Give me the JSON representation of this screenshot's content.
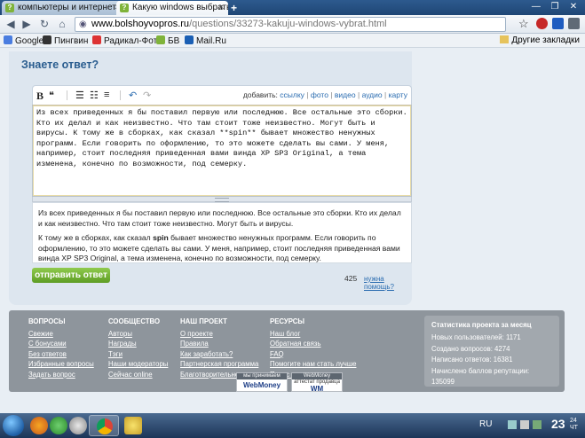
{
  "browser": {
    "tabs": [
      {
        "label": "компьютеры и интернет",
        "active": false
      },
      {
        "label": "Какую windows выбрать?",
        "active": true
      }
    ],
    "new_tab": "+",
    "address": {
      "host": "www.bolshoyvopros.ru",
      "path": "/questions/33273-kakuju-windows-vybrat.html"
    },
    "bookmarks": [
      "Google",
      "Пингвин",
      "Радикал-Фото",
      "БВ",
      "Mail.Ru"
    ],
    "other_bookmarks": "Другие закладки"
  },
  "answer": {
    "title": "Знаете ответ?",
    "toolbar": {
      "bold": "B",
      "quote": "❝",
      "add_label": "добавить:",
      "links": [
        "ссылку",
        "фото",
        "видео",
        "аудио",
        "карту"
      ],
      "separator": "|"
    },
    "textarea_text": "Из всех приведенных я бы поставил первую или последнюю. Все остальные это сборки. Кто их делал и как неизвестно. Что там стоит тоже неизвестно. Могут быть и вирусы. К тому же в сборках, как сказал **spin** бывает множество ненужных программ. Если говорить по оформлению, то это можете сделать вы сами. У меня, например, стоит последняя приведенная вами винда XP SP3 Original, а тема изменена, конечно по возможности, под семерку.",
    "preview": {
      "p1": "Из всех приведенных я бы поставил первую или последнюю. Все остальные это сборки. Кто их делал и как неизвестно. Что там стоит тоже неизвестно. Могут быть и вирусы.",
      "p2_before": "К тому же в сборках, как сказал ",
      "p2_bold": "spin",
      "p2_after": " бывает множество ненужных программ. Если говорить по оформлению, то это можете сделать вы сами. У меня, например, стоит последняя приведенная вами винда XP SP3 Original, а тема изменена, конечно по возможности, под семерку."
    },
    "submit_label": "отправить ответ",
    "char_count": "425",
    "help_link": "нужна помощь?"
  },
  "footer": {
    "columns": [
      {
        "title": "ВОПРОСЫ",
        "links": [
          "Свежие",
          "С бонусами",
          "Без ответов",
          "Избранные вопросы",
          "Задать вопрос"
        ]
      },
      {
        "title": "СООБЩЕСТВО",
        "links": [
          "Авторы",
          "Награды",
          "Тэги",
          "Наши модераторы",
          "Сейчас online"
        ]
      },
      {
        "title": "НАШ ПРОЕКТ",
        "links": [
          "О проекте",
          "Правила",
          "Как заработать?",
          "Партнерская программа",
          "Благотворительность"
        ]
      },
      {
        "title": "РЕСУРСЫ",
        "links": [
          "Наш блог",
          "Обратная связь",
          "FAQ",
          "Помогите нам стать лучше",
          "Пульс проекта"
        ]
      }
    ],
    "stats": {
      "title": "Статистика проекта за месяц",
      "lines": [
        "Новых пользователей: 1171",
        "Создано вопросов: 4274",
        "Написано ответов: 16381",
        "Начислено баллов репутации: 135099"
      ]
    },
    "badges": [
      {
        "top": "мы принимаем",
        "bottom": "WebMoney"
      },
      {
        "top": "WebMoney",
        "middle": "аттестат продавца",
        "bottom": "WM"
      }
    ]
  },
  "taskbar": {
    "language": "RU",
    "clock_big": "23",
    "clock_small_1": "24",
    "clock_small_2": "ЧТ"
  }
}
